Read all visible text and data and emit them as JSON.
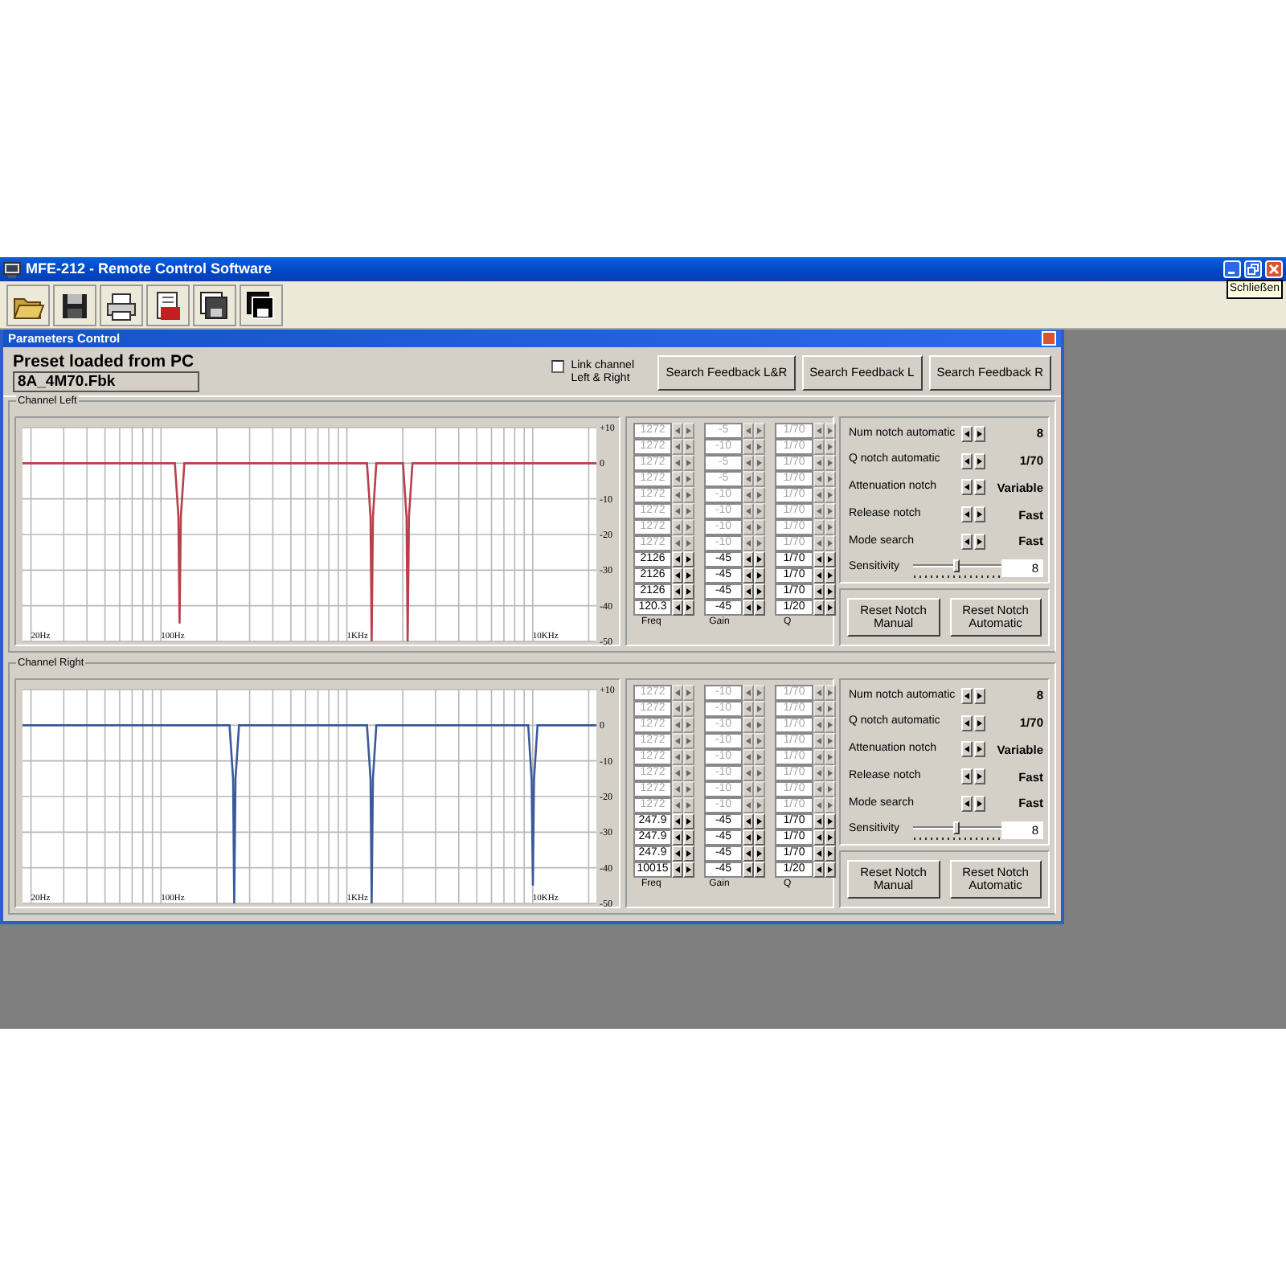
{
  "app": {
    "title": "MFE-212 - Remote Control Software",
    "tooltip": "Schließen"
  },
  "dialog": {
    "title": "Parameters Control",
    "preset_label": "Preset loaded from PC",
    "preset_value": "8A_4M70.Fbk",
    "link_checkbox": {
      "label": "Link channel Left & Right",
      "checked": false
    },
    "buttons": [
      "Search Feedback L&R",
      "Search Feedback L",
      "Search Feedback R"
    ]
  },
  "channels": [
    {
      "title": "Channel Left",
      "graph": {
        "color": "#b8404a",
        "x_labels": [
          "20Hz",
          "100Hz",
          "1KHz",
          "10KHz"
        ],
        "y_labels": [
          "+10",
          "0",
          "-10",
          "-20",
          "-30",
          "-40",
          "-50"
        ]
      },
      "notch_table": {
        "columns": [
          "Freq",
          "Gain",
          "Q"
        ],
        "rows": [
          {
            "freq": "1272",
            "gain": "-5",
            "q": "1/70",
            "disabled": true
          },
          {
            "freq": "1272",
            "gain": "-10",
            "q": "1/70",
            "disabled": true
          },
          {
            "freq": "1272",
            "gain": "-5",
            "q": "1/70",
            "disabled": true
          },
          {
            "freq": "1272",
            "gain": "-5",
            "q": "1/70",
            "disabled": true
          },
          {
            "freq": "1272",
            "gain": "-10",
            "q": "1/70",
            "disabled": true
          },
          {
            "freq": "1272",
            "gain": "-10",
            "q": "1/70",
            "disabled": true
          },
          {
            "freq": "1272",
            "gain": "-10",
            "q": "1/70",
            "disabled": true
          },
          {
            "freq": "1272",
            "gain": "-10",
            "q": "1/70",
            "disabled": true
          },
          {
            "freq": "2126",
            "gain": "-45",
            "q": "1/70",
            "disabled": false
          },
          {
            "freq": "2126",
            "gain": "-45",
            "q": "1/70",
            "disabled": false
          },
          {
            "freq": "2126",
            "gain": "-45",
            "q": "1/70",
            "disabled": false
          },
          {
            "freq": "120.3",
            "gain": "-45",
            "q": "1/20",
            "disabled": false
          }
        ]
      },
      "settings": [
        {
          "label": "Num notch automatic",
          "value": "8"
        },
        {
          "label": "Q notch automatic",
          "value": "1/70"
        },
        {
          "label": "Attenuation notch",
          "value": "Variable"
        },
        {
          "label": "Release notch",
          "value": "Fast"
        },
        {
          "label": "Mode search",
          "value": "Fast"
        }
      ],
      "sensitivity": {
        "label": "Sensitivity",
        "level": 0.5,
        "value": "8"
      },
      "buttons": [
        "Reset Notch Manual",
        "Reset Notch Automatic"
      ]
    },
    {
      "title": "Channel Right",
      "graph": {
        "color": "#3a5a9a",
        "x_labels": [
          "20Hz",
          "100Hz",
          "1KHz",
          "10KHz"
        ],
        "y_labels": [
          "+10",
          "0",
          "-10",
          "-20",
          "-30",
          "-40",
          "-50"
        ]
      },
      "notch_table": {
        "columns": [
          "Freq",
          "Gain",
          "Q"
        ],
        "rows": [
          {
            "freq": "1272",
            "gain": "-10",
            "q": "1/70",
            "disabled": true
          },
          {
            "freq": "1272",
            "gain": "-10",
            "q": "1/70",
            "disabled": true
          },
          {
            "freq": "1272",
            "gain": "-10",
            "q": "1/70",
            "disabled": true
          },
          {
            "freq": "1272",
            "gain": "-10",
            "q": "1/70",
            "disabled": true
          },
          {
            "freq": "1272",
            "gain": "-10",
            "q": "1/70",
            "disabled": true
          },
          {
            "freq": "1272",
            "gain": "-10",
            "q": "1/70",
            "disabled": true
          },
          {
            "freq": "1272",
            "gain": "-10",
            "q": "1/70",
            "disabled": true
          },
          {
            "freq": "1272",
            "gain": "-10",
            "q": "1/70",
            "disabled": true
          },
          {
            "freq": "247.9",
            "gain": "-45",
            "q": "1/70",
            "disabled": false
          },
          {
            "freq": "247.9",
            "gain": "-45",
            "q": "1/70",
            "disabled": false
          },
          {
            "freq": "247.9",
            "gain": "-45",
            "q": "1/70",
            "disabled": false
          },
          {
            "freq": "10015",
            "gain": "-45",
            "q": "1/20",
            "disabled": false
          }
        ]
      },
      "settings": [
        {
          "label": "Num notch automatic",
          "value": "8"
        },
        {
          "label": "Q notch automatic",
          "value": "1/70"
        },
        {
          "label": "Attenuation notch",
          "value": "Variable"
        },
        {
          "label": "Release notch",
          "value": "Fast"
        },
        {
          "label": "Mode search",
          "value": "Fast"
        }
      ],
      "sensitivity": {
        "label": "Sensitivity",
        "level": 0.5,
        "value": "8"
      },
      "buttons": [
        "Reset Notch Manual",
        "Reset Notch Automatic"
      ]
    }
  ]
}
